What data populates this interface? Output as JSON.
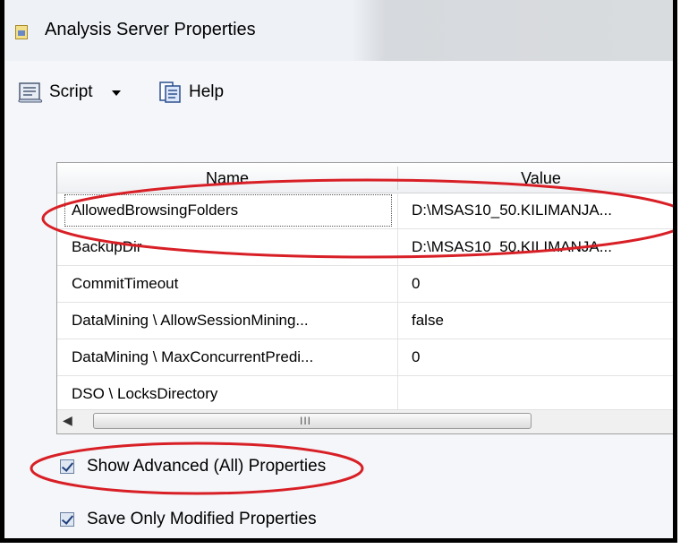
{
  "window": {
    "title": "Analysis Server Properties"
  },
  "toolbar": {
    "script_label": "Script",
    "help_label": "Help"
  },
  "grid": {
    "columns": {
      "name": "Name",
      "value": "Value"
    },
    "rows": [
      {
        "name": "AllowedBrowsingFolders",
        "value": "D:\\MSAS10_50.KILIMANJA..."
      },
      {
        "name": "BackupDir",
        "value": "D:\\MSAS10_50.KILIMANJA..."
      },
      {
        "name": "CommitTimeout",
        "value": "0"
      },
      {
        "name": "DataMining \\ AllowSessionMining...",
        "value": "false"
      },
      {
        "name": "DataMining \\ MaxConcurrentPredi...",
        "value": "0"
      },
      {
        "name": "DSO \\ LocksDirectory",
        "value": ""
      }
    ],
    "scrollbar": {
      "grip": "III"
    }
  },
  "options": {
    "show_advanced": {
      "label": "Show Advanced (All) Properties",
      "checked": true
    },
    "save_modified": {
      "label": "Save Only Modified Properties",
      "checked": true
    }
  },
  "colors": {
    "annotation": "#d81f26"
  }
}
